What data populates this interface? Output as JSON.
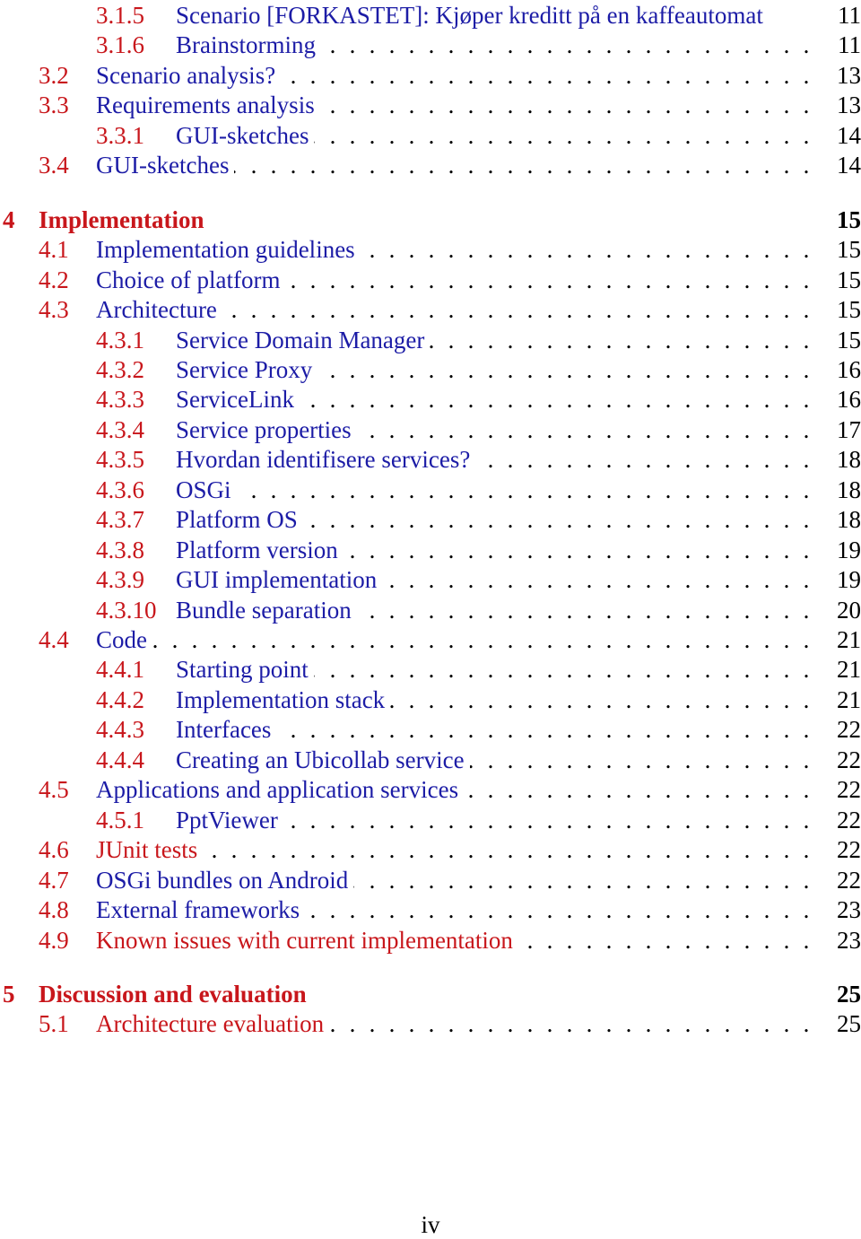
{
  "colors": {
    "number": "#c8161b",
    "title_link": "#1c1ca6",
    "title_red": "#c8161b",
    "page": "#000000"
  },
  "toc": {
    "entries": [
      {
        "level": 2,
        "number": "3.1.5",
        "title": "Scenario [FORKASTET]: Kjøper kreditt på en kaffeautomat",
        "page": "11",
        "dots": false,
        "title_color": "blue"
      },
      {
        "level": 2,
        "number": "3.1.6",
        "title": "Brainstorming",
        "page": "11",
        "dots": true,
        "title_color": "blue"
      },
      {
        "level": 1,
        "number": "3.2",
        "title": "Scenario analysis?",
        "page": "13",
        "dots": true,
        "title_color": "blue"
      },
      {
        "level": 1,
        "number": "3.3",
        "title": "Requirements analysis",
        "page": "13",
        "dots": true,
        "title_color": "blue"
      },
      {
        "level": 2,
        "number": "3.3.1",
        "title": "GUI-sketches",
        "page": "14",
        "dots": true,
        "title_color": "blue"
      },
      {
        "level": 1,
        "number": "3.4",
        "title": "GUI-sketches",
        "page": "14",
        "dots": true,
        "title_color": "blue"
      },
      {
        "level": 0,
        "number": "4",
        "title": "Implementation",
        "page": "15",
        "dots": false,
        "title_color": "red"
      },
      {
        "level": 1,
        "number": "4.1",
        "title": "Implementation guidelines",
        "page": "15",
        "dots": true,
        "title_color": "blue"
      },
      {
        "level": 1,
        "number": "4.2",
        "title": "Choice of platform",
        "page": "15",
        "dots": true,
        "title_color": "blue"
      },
      {
        "level": 1,
        "number": "4.3",
        "title": "Architecture",
        "page": "15",
        "dots": true,
        "title_color": "blue"
      },
      {
        "level": 2,
        "number": "4.3.1",
        "title": "Service Domain Manager",
        "page": "15",
        "dots": true,
        "title_color": "blue"
      },
      {
        "level": 2,
        "number": "4.3.2",
        "title": "Service Proxy",
        "page": "16",
        "dots": true,
        "title_color": "blue"
      },
      {
        "level": 2,
        "number": "4.3.3",
        "title": "ServiceLink",
        "page": "16",
        "dots": true,
        "title_color": "blue"
      },
      {
        "level": 2,
        "number": "4.3.4",
        "title": "Service properties",
        "page": "17",
        "dots": true,
        "title_color": "blue"
      },
      {
        "level": 2,
        "number": "4.3.5",
        "title": "Hvordan identifisere services?",
        "page": "18",
        "dots": true,
        "title_color": "blue"
      },
      {
        "level": 2,
        "number": "4.3.6",
        "title": "OSGi",
        "page": "18",
        "dots": true,
        "title_color": "blue"
      },
      {
        "level": 2,
        "number": "4.3.7",
        "title": "Platform OS",
        "page": "18",
        "dots": true,
        "title_color": "blue"
      },
      {
        "level": 2,
        "number": "4.3.8",
        "title": "Platform version",
        "page": "19",
        "dots": true,
        "title_color": "blue"
      },
      {
        "level": 2,
        "number": "4.3.9",
        "title": "GUI implementation",
        "page": "19",
        "dots": true,
        "title_color": "blue"
      },
      {
        "level": 2,
        "number": "4.3.10",
        "title": "Bundle separation",
        "page": "20",
        "dots": true,
        "title_color": "blue"
      },
      {
        "level": 1,
        "number": "4.4",
        "title": "Code",
        "page": "21",
        "dots": true,
        "title_color": "blue"
      },
      {
        "level": 2,
        "number": "4.4.1",
        "title": "Starting point",
        "page": "21",
        "dots": true,
        "title_color": "blue"
      },
      {
        "level": 2,
        "number": "4.4.2",
        "title": "Implementation stack",
        "page": "21",
        "dots": true,
        "title_color": "blue"
      },
      {
        "level": 2,
        "number": "4.4.3",
        "title": "Interfaces",
        "page": "22",
        "dots": true,
        "title_color": "blue"
      },
      {
        "level": 2,
        "number": "4.4.4",
        "title": "Creating an Ubicollab service",
        "page": "22",
        "dots": true,
        "title_color": "blue"
      },
      {
        "level": 1,
        "number": "4.5",
        "title": "Applications and application services",
        "page": "22",
        "dots": true,
        "title_color": "blue"
      },
      {
        "level": 2,
        "number": "4.5.1",
        "title": "PptViewer",
        "page": "22",
        "dots": true,
        "title_color": "blue"
      },
      {
        "level": 1,
        "number": "4.6",
        "title": "JUnit tests",
        "page": "22",
        "dots": true,
        "title_color": "red"
      },
      {
        "level": 1,
        "number": "4.7",
        "title": "OSGi bundles on Android",
        "page": "22",
        "dots": true,
        "title_color": "blue"
      },
      {
        "level": 1,
        "number": "4.8",
        "title": "External frameworks",
        "page": "23",
        "dots": true,
        "title_color": "blue"
      },
      {
        "level": 1,
        "number": "4.9",
        "title": "Known issues with current implementation",
        "page": "23",
        "dots": true,
        "title_color": "red"
      },
      {
        "level": 0,
        "number": "5",
        "title": "Discussion and evaluation",
        "page": "25",
        "dots": false,
        "title_color": "red"
      },
      {
        "level": 1,
        "number": "5.1",
        "title": "Architecture evaluation",
        "page": "25",
        "dots": true,
        "title_color": "red"
      }
    ]
  },
  "footer": {
    "page_number": "iv"
  }
}
